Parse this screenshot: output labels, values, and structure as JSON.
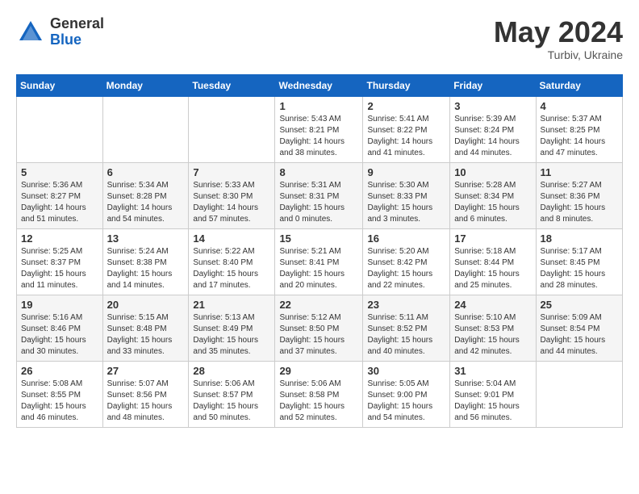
{
  "header": {
    "logo": {
      "general": "General",
      "blue": "Blue"
    },
    "title": "May 2024",
    "location": "Turbiv, Ukraine"
  },
  "days_of_week": [
    "Sunday",
    "Monday",
    "Tuesday",
    "Wednesday",
    "Thursday",
    "Friday",
    "Saturday"
  ],
  "weeks": [
    [
      {
        "day": "",
        "content": ""
      },
      {
        "day": "",
        "content": ""
      },
      {
        "day": "",
        "content": ""
      },
      {
        "day": "1",
        "content": "Sunrise: 5:43 AM\nSunset: 8:21 PM\nDaylight: 14 hours\nand 38 minutes."
      },
      {
        "day": "2",
        "content": "Sunrise: 5:41 AM\nSunset: 8:22 PM\nDaylight: 14 hours\nand 41 minutes."
      },
      {
        "day": "3",
        "content": "Sunrise: 5:39 AM\nSunset: 8:24 PM\nDaylight: 14 hours\nand 44 minutes."
      },
      {
        "day": "4",
        "content": "Sunrise: 5:37 AM\nSunset: 8:25 PM\nDaylight: 14 hours\nand 47 minutes."
      }
    ],
    [
      {
        "day": "5",
        "content": "Sunrise: 5:36 AM\nSunset: 8:27 PM\nDaylight: 14 hours\nand 51 minutes."
      },
      {
        "day": "6",
        "content": "Sunrise: 5:34 AM\nSunset: 8:28 PM\nDaylight: 14 hours\nand 54 minutes."
      },
      {
        "day": "7",
        "content": "Sunrise: 5:33 AM\nSunset: 8:30 PM\nDaylight: 14 hours\nand 57 minutes."
      },
      {
        "day": "8",
        "content": "Sunrise: 5:31 AM\nSunset: 8:31 PM\nDaylight: 15 hours\nand 0 minutes."
      },
      {
        "day": "9",
        "content": "Sunrise: 5:30 AM\nSunset: 8:33 PM\nDaylight: 15 hours\nand 3 minutes."
      },
      {
        "day": "10",
        "content": "Sunrise: 5:28 AM\nSunset: 8:34 PM\nDaylight: 15 hours\nand 6 minutes."
      },
      {
        "day": "11",
        "content": "Sunrise: 5:27 AM\nSunset: 8:36 PM\nDaylight: 15 hours\nand 8 minutes."
      }
    ],
    [
      {
        "day": "12",
        "content": "Sunrise: 5:25 AM\nSunset: 8:37 PM\nDaylight: 15 hours\nand 11 minutes."
      },
      {
        "day": "13",
        "content": "Sunrise: 5:24 AM\nSunset: 8:38 PM\nDaylight: 15 hours\nand 14 minutes."
      },
      {
        "day": "14",
        "content": "Sunrise: 5:22 AM\nSunset: 8:40 PM\nDaylight: 15 hours\nand 17 minutes."
      },
      {
        "day": "15",
        "content": "Sunrise: 5:21 AM\nSunset: 8:41 PM\nDaylight: 15 hours\nand 20 minutes."
      },
      {
        "day": "16",
        "content": "Sunrise: 5:20 AM\nSunset: 8:42 PM\nDaylight: 15 hours\nand 22 minutes."
      },
      {
        "day": "17",
        "content": "Sunrise: 5:18 AM\nSunset: 8:44 PM\nDaylight: 15 hours\nand 25 minutes."
      },
      {
        "day": "18",
        "content": "Sunrise: 5:17 AM\nSunset: 8:45 PM\nDaylight: 15 hours\nand 28 minutes."
      }
    ],
    [
      {
        "day": "19",
        "content": "Sunrise: 5:16 AM\nSunset: 8:46 PM\nDaylight: 15 hours\nand 30 minutes."
      },
      {
        "day": "20",
        "content": "Sunrise: 5:15 AM\nSunset: 8:48 PM\nDaylight: 15 hours\nand 33 minutes."
      },
      {
        "day": "21",
        "content": "Sunrise: 5:13 AM\nSunset: 8:49 PM\nDaylight: 15 hours\nand 35 minutes."
      },
      {
        "day": "22",
        "content": "Sunrise: 5:12 AM\nSunset: 8:50 PM\nDaylight: 15 hours\nand 37 minutes."
      },
      {
        "day": "23",
        "content": "Sunrise: 5:11 AM\nSunset: 8:52 PM\nDaylight: 15 hours\nand 40 minutes."
      },
      {
        "day": "24",
        "content": "Sunrise: 5:10 AM\nSunset: 8:53 PM\nDaylight: 15 hours\nand 42 minutes."
      },
      {
        "day": "25",
        "content": "Sunrise: 5:09 AM\nSunset: 8:54 PM\nDaylight: 15 hours\nand 44 minutes."
      }
    ],
    [
      {
        "day": "26",
        "content": "Sunrise: 5:08 AM\nSunset: 8:55 PM\nDaylight: 15 hours\nand 46 minutes."
      },
      {
        "day": "27",
        "content": "Sunrise: 5:07 AM\nSunset: 8:56 PM\nDaylight: 15 hours\nand 48 minutes."
      },
      {
        "day": "28",
        "content": "Sunrise: 5:06 AM\nSunset: 8:57 PM\nDaylight: 15 hours\nand 50 minutes."
      },
      {
        "day": "29",
        "content": "Sunrise: 5:06 AM\nSunset: 8:58 PM\nDaylight: 15 hours\nand 52 minutes."
      },
      {
        "day": "30",
        "content": "Sunrise: 5:05 AM\nSunset: 9:00 PM\nDaylight: 15 hours\nand 54 minutes."
      },
      {
        "day": "31",
        "content": "Sunrise: 5:04 AM\nSunset: 9:01 PM\nDaylight: 15 hours\nand 56 minutes."
      },
      {
        "day": "",
        "content": ""
      }
    ]
  ]
}
